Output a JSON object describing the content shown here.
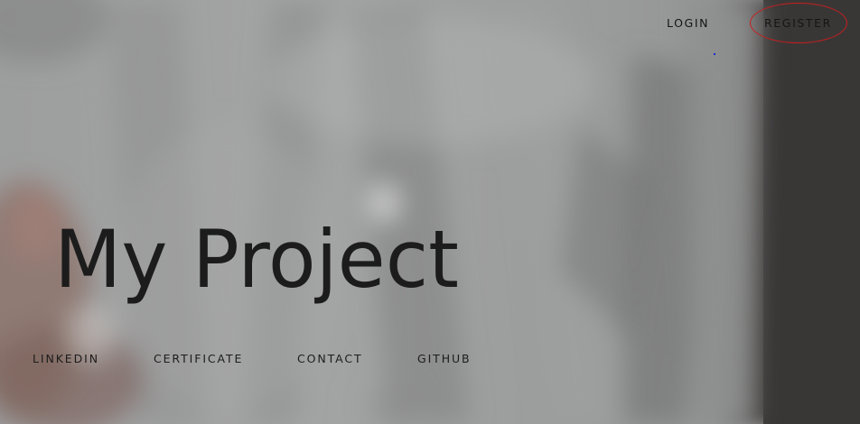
{
  "header": {
    "login_label": "LOGIN",
    "register_label": "REGISTER"
  },
  "hero": {
    "title": "My Project"
  },
  "footer_nav": {
    "items": [
      {
        "label": "LINKEDIN"
      },
      {
        "label": "CERTIFICATE"
      },
      {
        "label": "CONTACT"
      },
      {
        "label": "GITHUB"
      }
    ]
  },
  "colors": {
    "text": "#1c1c1c",
    "background_grey": "#8e8f8f",
    "dark_side": "#3b3938",
    "register_circle": "#c81e1e"
  }
}
